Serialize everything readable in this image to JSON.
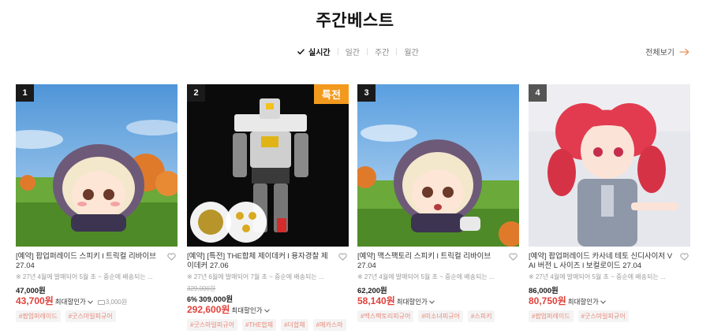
{
  "page_title": "주간베스트",
  "tabs": [
    {
      "label": "실시간",
      "active": true
    },
    {
      "label": "일간",
      "active": false
    },
    {
      "label": "주간",
      "active": false
    },
    {
      "label": "월간",
      "active": false
    }
  ],
  "view_all_label": "전체보기",
  "colors": {
    "accent": "#e0413c",
    "badge_orange": "#f39a1e",
    "tag_text": "#e88a7c"
  },
  "products": [
    {
      "rank": "1",
      "name": "[예약] 팝업퍼레이드 스피키 l 트릭컬 리바이브 27.04",
      "subtitle": "※ 27년 4월에 발매되어 5월 초 ~ 중순에 배송되는 ...",
      "price": "47,000원",
      "sale_price": "43,700원",
      "max_discount_label": "최대할인가",
      "coupon": "3,000원",
      "tags": [
        "#팝업퍼레이드",
        "#굿스마일피규어"
      ]
    },
    {
      "rank": "2",
      "badge": "특전",
      "name": "[예약] [특전] THE합체 제이데커 l 용자경찰 제이데커 27.06",
      "subtitle": "※ 27년 6월에 발매되어 7월 초 ~ 중순에 배송되는 ...",
      "original_price": "329,000원",
      "discount_percent": "6%",
      "discounted_price": "309,000원",
      "sale_price": "292,600원",
      "max_discount_label": "최대할인가",
      "tags": [
        "#굿스마일피규어",
        "#THE합체",
        "#더합체",
        "#메카스마"
      ]
    },
    {
      "rank": "3",
      "name": "[예약] 맥스팩토리 스피키 l 트릭컬 리바이브 27.04",
      "subtitle": "※ 27년 4월에 발매되어 5월 초 ~ 중순에 배송되는 ...",
      "price": "62,200원",
      "sale_price": "58,140원",
      "max_discount_label": "최대할인가",
      "tags": [
        "#맥스팩토리피규어",
        "#미소녀피규어",
        "#스피키"
      ]
    },
    {
      "rank": "4",
      "name": "[예약] 팝업퍼레이드 카사네 테토 신디사이저 V AI 버전 L 사이즈 l 보컬로이드 27.04",
      "subtitle": "※ 27년 4월에 발매되어 5월 초 ~ 중순에 배송되는 ...",
      "price": "86,000원",
      "sale_price": "80,750원",
      "max_discount_label": "최대할인가",
      "tags": [
        "#팝업퍼레이드",
        "#굿스마일피규어"
      ]
    }
  ]
}
